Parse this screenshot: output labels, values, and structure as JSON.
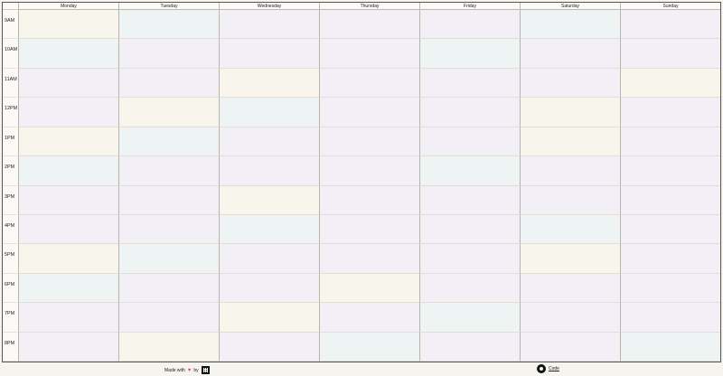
{
  "calendar": {
    "days": [
      "Monday",
      "Tuesday",
      "Wednesday",
      "Thursday",
      "Friday",
      "Saturday",
      "Sunday"
    ],
    "times": [
      "9AM",
      "10AM",
      "11AM",
      "12PM",
      "1PM",
      "2PM",
      "3PM",
      "4PM",
      "5PM",
      "6PM",
      "7PM",
      "8PM"
    ],
    "cell_colors": {
      "cream": "#f7f5ec",
      "mint": "#edf4f3",
      "lavender": "#f3eff6"
    }
  },
  "footer": {
    "made_with_prefix": "Made with",
    "made_with_suffix": "by",
    "heart_icon": "heart-icon",
    "code_label": "Code",
    "code_icon": "github-icon"
  }
}
